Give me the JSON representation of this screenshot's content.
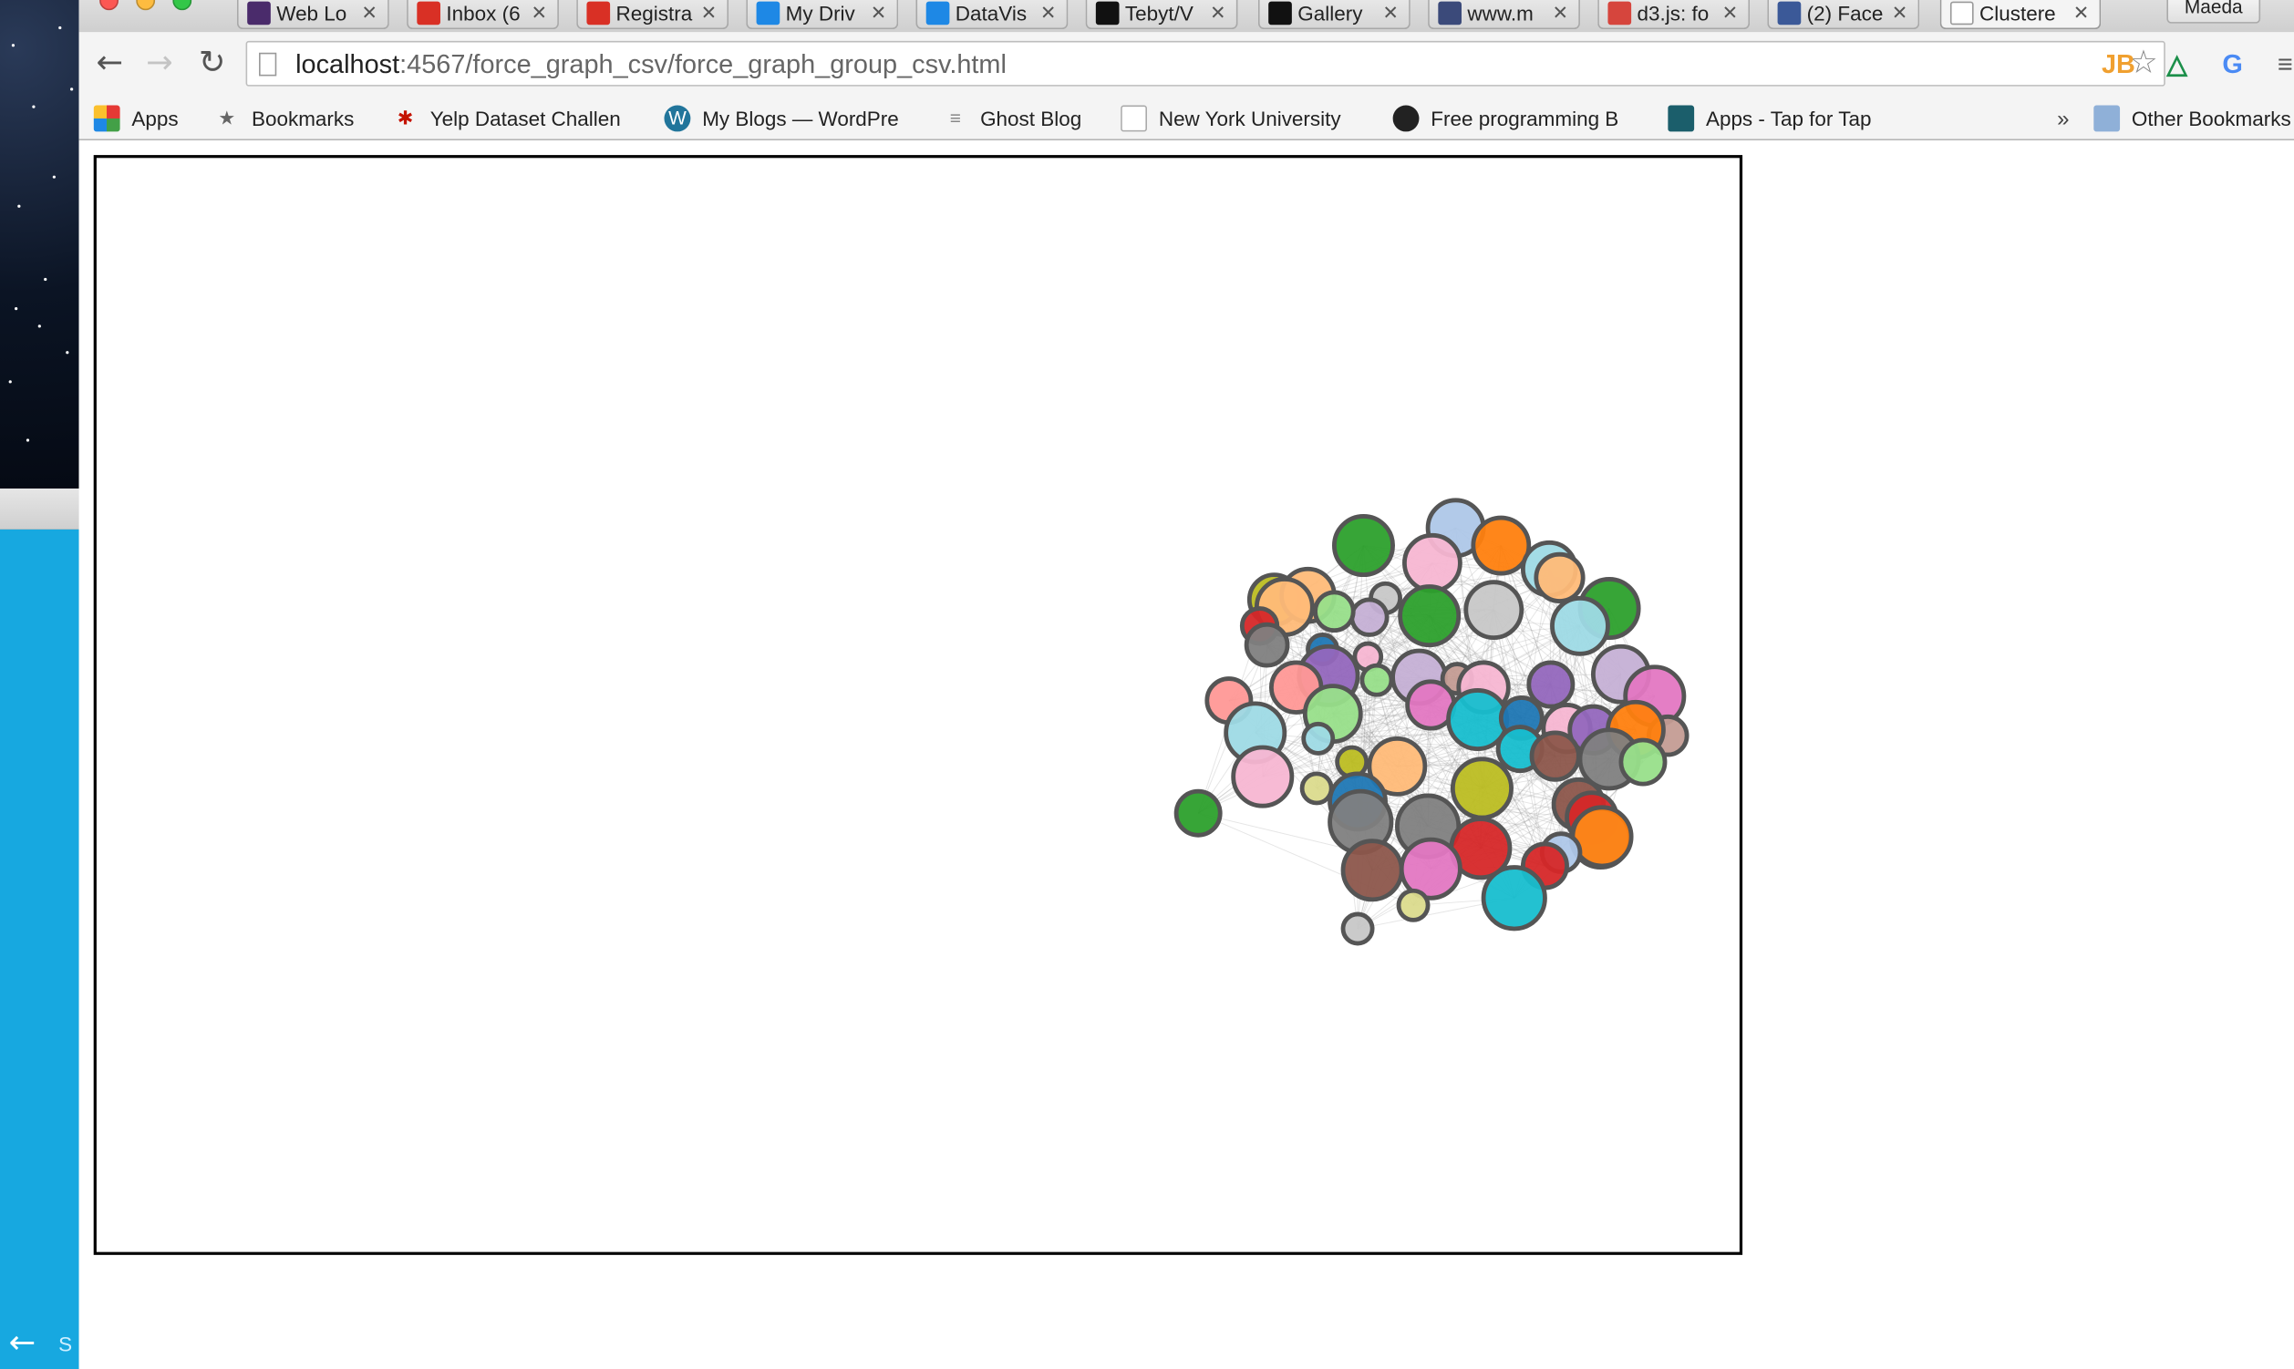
{
  "browser": {
    "tabs": [
      {
        "title": "Web Lo",
        "icon": "web-logo-icon",
        "color": "#4a2b6b"
      },
      {
        "title": "Inbox (6",
        "icon": "gmail-icon",
        "color": "#d93025"
      },
      {
        "title": "Registra",
        "icon": "gmail-icon",
        "color": "#d93025"
      },
      {
        "title": "My Driv",
        "icon": "google-drive-icon",
        "color": "#1e88e5"
      },
      {
        "title": "DataVis",
        "icon": "google-drive-icon",
        "color": "#1e88e5"
      },
      {
        "title": "Tebyt/V",
        "icon": "github-icon",
        "color": "#111111"
      },
      {
        "title": "Gallery",
        "icon": "github-icon",
        "color": "#111111"
      },
      {
        "title": "www.m",
        "icon": "shield-icon",
        "color": "#3b4a7a"
      },
      {
        "title": "d3.js: fo",
        "icon": "d3-icon",
        "color": "#d6453d"
      },
      {
        "title": "(2) Face",
        "icon": "facebook-icon",
        "color": "#3b5998"
      },
      {
        "title": "Clustere",
        "icon": "page-icon",
        "color": "#ffffff"
      }
    ],
    "profile_name": "Maeda",
    "url_host": "localhost",
    "url_path": ":4567/force_graph_csv/force_graph_group_csv.html",
    "bookmarks": [
      {
        "label": "Apps",
        "icon": "apps-grid-icon"
      },
      {
        "label": "Bookmarks",
        "icon": "star-icon"
      },
      {
        "label": "Yelp Dataset Challen",
        "icon": "yelp-icon"
      },
      {
        "label": "My Blogs — WordPre",
        "icon": "wordpress-icon"
      },
      {
        "label": "Ghost Blog",
        "icon": "ghost-icon"
      },
      {
        "label": "New York University",
        "icon": "page-icon"
      },
      {
        "label": "Free programming B",
        "icon": "github-icon"
      },
      {
        "label": "Apps - Tap for Tap",
        "icon": "tap-icon"
      }
    ],
    "overflow_chevron": "»",
    "other_bookmarks": "Other Bookmarks"
  },
  "desktop": {
    "dock_text": "S"
  },
  "graph": {
    "palette": {
      "blue": "#1f77b4",
      "light_blue": "#aec7e8",
      "orange": "#ff7f0e",
      "light_orange": "#ffbb78",
      "green": "#2ca02c",
      "light_green": "#98df8a",
      "red": "#d62728",
      "pink_red": "#ff9896",
      "purple": "#9467bd",
      "light_purple": "#c5b0d5",
      "brown": "#8c564b",
      "light_brown": "#c49c94",
      "magenta": "#e377c2",
      "pink": "#f7b6d2",
      "gray": "#7f7f7f",
      "light_gray": "#c7c7c7",
      "olive": "#bcbd22",
      "light_olive": "#dbdb8d",
      "teal": "#17becf",
      "light_teal": "#9edae5"
    },
    "node_stroke": "#555555",
    "link_color": "#999999"
  }
}
